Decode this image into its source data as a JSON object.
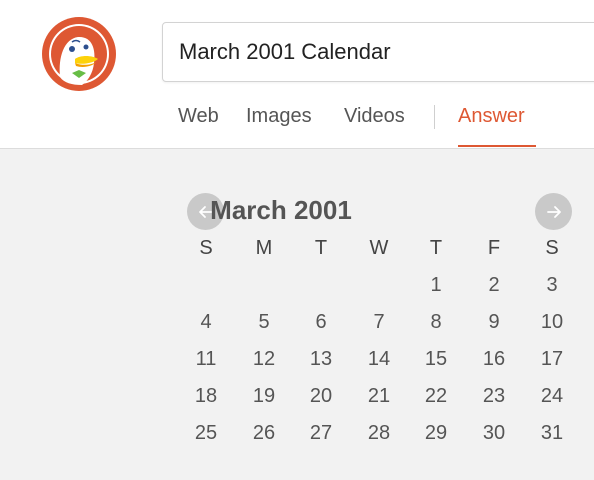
{
  "search": {
    "value": "March 2001 Calendar"
  },
  "tabs": [
    {
      "label": "Web",
      "active": false
    },
    {
      "label": "Images",
      "active": false
    },
    {
      "label": "Videos",
      "active": false
    },
    {
      "label": "Answer",
      "active": true
    }
  ],
  "calendar": {
    "title": "March 2001",
    "weekdays": [
      "S",
      "M",
      "T",
      "W",
      "T",
      "F",
      "S"
    ],
    "weeks": [
      [
        "",
        "",
        "",
        "",
        "1",
        "2",
        "3"
      ],
      [
        "4",
        "5",
        "6",
        "7",
        "8",
        "9",
        "10"
      ],
      [
        "11",
        "12",
        "13",
        "14",
        "15",
        "16",
        "17"
      ],
      [
        "18",
        "19",
        "20",
        "21",
        "22",
        "23",
        "24"
      ],
      [
        "25",
        "26",
        "27",
        "28",
        "29",
        "30",
        "31"
      ]
    ]
  },
  "colors": {
    "accent": "#de5833",
    "text": "#555555",
    "background": "#f2f2f2"
  },
  "icons": {
    "prev": "arrow-left-icon",
    "next": "arrow-right-icon",
    "logo": "duck-logo-icon"
  }
}
